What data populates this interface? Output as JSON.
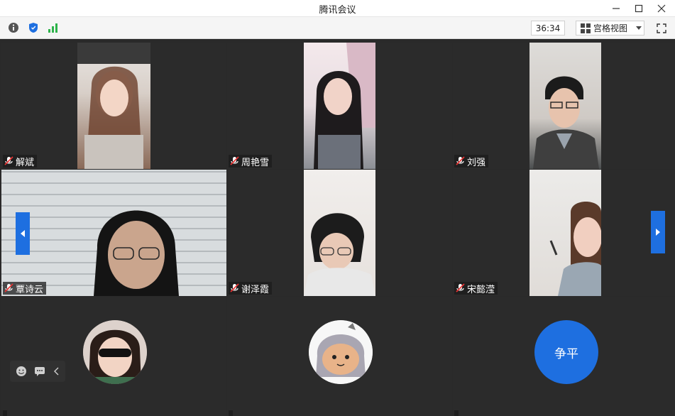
{
  "window": {
    "title": "腾讯会议"
  },
  "toolbar": {
    "icons": [
      "info-icon",
      "shield-icon",
      "signal-icon"
    ],
    "timer": "36:34",
    "view_label": "宫格视图",
    "fullscreen_icon": "fullscreen-icon"
  },
  "colors": {
    "accent": "#1e6fe0",
    "tile_bg": "#2b2b2b",
    "avatar_blue": "#1e6fe0"
  },
  "participants": [
    {
      "name": "解斌"
    },
    {
      "name": "周艳雪"
    },
    {
      "name": "刘强"
    },
    {
      "name": "覃诗云"
    },
    {
      "name": "谢泽霞"
    },
    {
      "name": "宋懿滢"
    },
    {
      "name": ""
    },
    {
      "name": ""
    },
    {
      "name": "",
      "avatar_text": "争平"
    }
  ],
  "floatbar": {
    "icons": [
      "emoji-icon",
      "chat-icon",
      "collapse-left-icon"
    ]
  }
}
